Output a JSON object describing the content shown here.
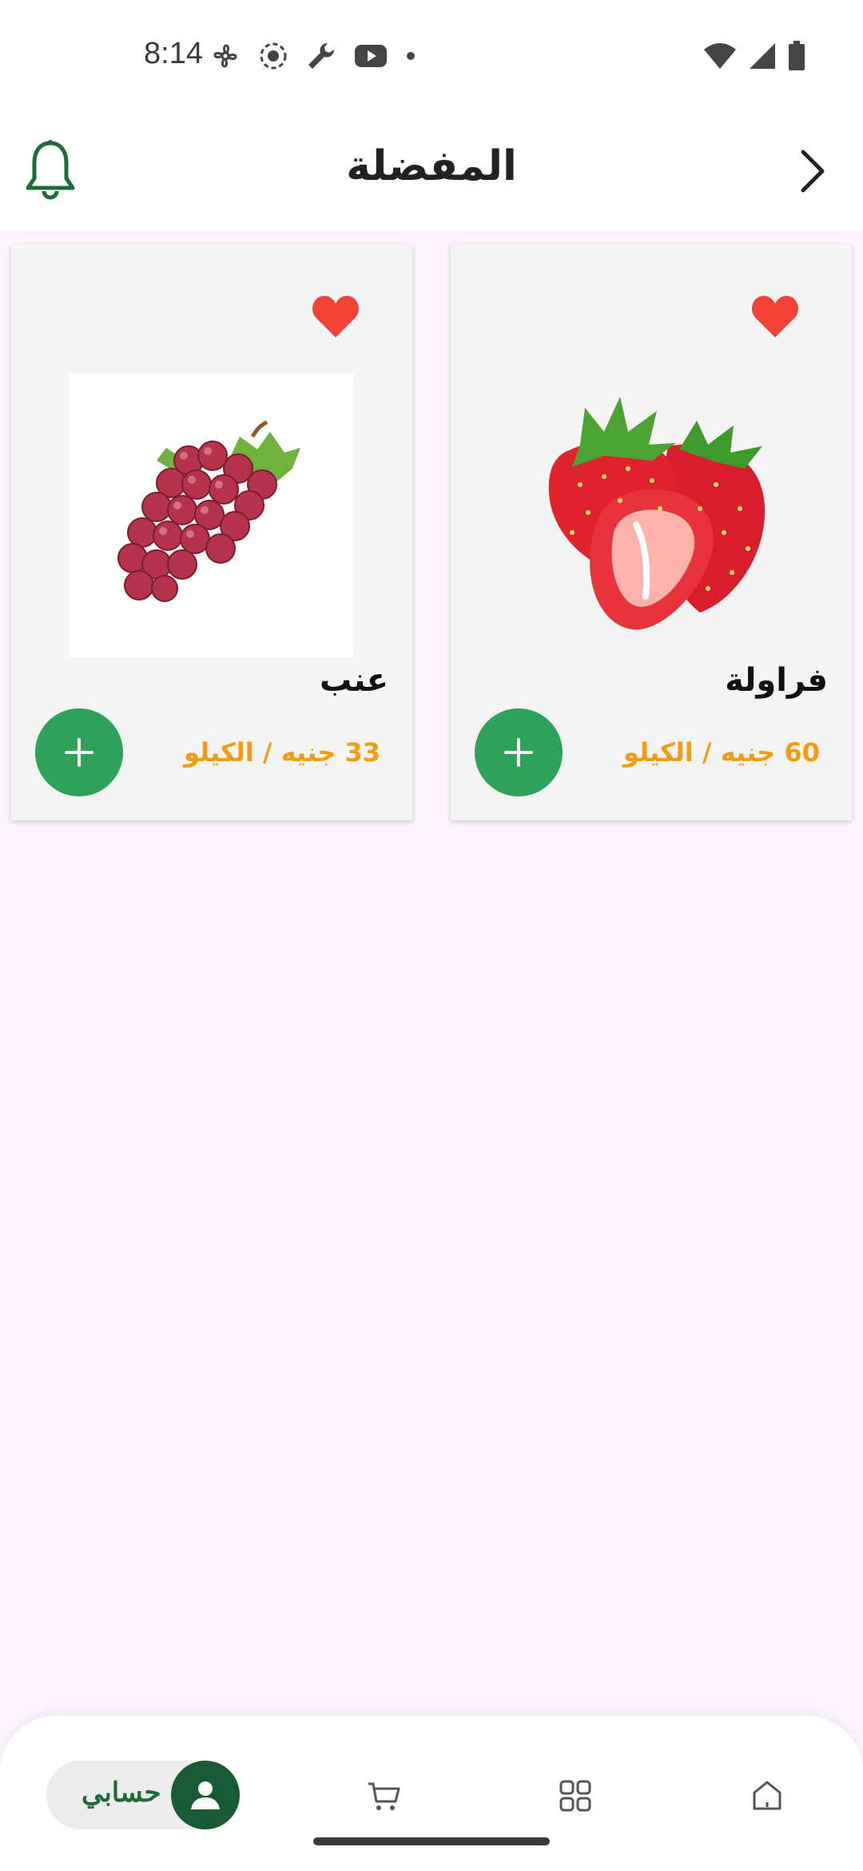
{
  "status_bar": {
    "time": "8:14",
    "left_icons": [
      "fan-icon",
      "record-icon",
      "wrench-icon",
      "youtube-icon",
      "dot-icon"
    ],
    "right_icons": [
      "wifi-icon",
      "signal-icon",
      "battery-icon"
    ]
  },
  "header": {
    "title": "المفضلة",
    "back_icon": "chevron-right-icon",
    "notification_icon": "bell-icon"
  },
  "products": [
    {
      "name": "فراولة",
      "price": "60 جنيه / الكيلو",
      "image": "strawberry",
      "favorite": true
    },
    {
      "name": "عنب",
      "price": "33 جنيه / الكيلو",
      "image": "grapes",
      "favorite": true
    }
  ],
  "colors": {
    "accent_green": "#2ea25a",
    "dark_green": "#175a33",
    "price_orange": "#f39c12",
    "favorite_red": "#f44336",
    "background": "#fbf4fc"
  },
  "bottom_nav": {
    "account_label": "حسابي",
    "items": [
      "account-icon",
      "cart-icon",
      "categories-icon",
      "home-icon"
    ]
  }
}
